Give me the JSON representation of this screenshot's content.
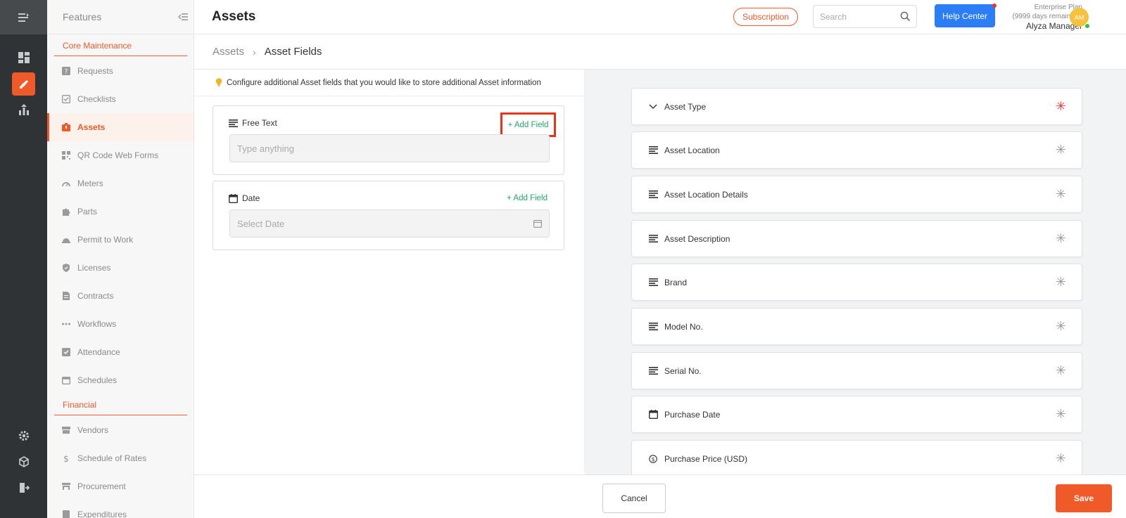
{
  "colors": {
    "accent": "#f05a28",
    "help": "#2c7ef8",
    "success": "#21a66a",
    "required": "#f03a2e"
  },
  "features": {
    "title": "Features",
    "sections": [
      {
        "title": "Core Maintenance",
        "items": [
          {
            "label": "Requests",
            "icon": "question-box-icon"
          },
          {
            "label": "Checklists",
            "icon": "checklist-icon"
          },
          {
            "label": "Assets",
            "icon": "asset-box-icon",
            "active": true
          },
          {
            "label": "QR Code Web Forms",
            "icon": "qr-code-icon"
          },
          {
            "label": "Meters",
            "icon": "gauge-icon"
          },
          {
            "label": "Parts",
            "icon": "puzzle-icon"
          },
          {
            "label": "Permit to Work",
            "icon": "helmet-icon"
          },
          {
            "label": "Licenses",
            "icon": "shield-icon"
          },
          {
            "label": "Contracts",
            "icon": "contract-icon"
          },
          {
            "label": "Workflows",
            "icon": "workflow-dots-icon"
          },
          {
            "label": "Attendance",
            "icon": "attendance-icon"
          },
          {
            "label": "Schedules",
            "icon": "calendar-icon"
          }
        ]
      },
      {
        "title": "Financial",
        "items": [
          {
            "label": "Vendors",
            "icon": "store-icon"
          },
          {
            "label": "Schedule of Rates",
            "icon": "dollar-icon"
          },
          {
            "label": "Procurement",
            "icon": "procurement-icon"
          },
          {
            "label": "Expenditures",
            "icon": "expenditure-icon"
          }
        ]
      }
    ]
  },
  "header": {
    "title": "Assets",
    "subscription_label": "Subscription",
    "search_placeholder": "Search",
    "help_label": "Help Center",
    "plan_name": "Enterprise Plan",
    "plan_remaining": "(9999 days remaining)",
    "user_name": "Alyza Manager",
    "avatar_initials": "AM"
  },
  "breadcrumb": {
    "root": "Assets",
    "current": "Asset Fields"
  },
  "left": {
    "hint": "Configure additional Asset fields that you would like to store additional Asset information",
    "fields": [
      {
        "label": "Free Text",
        "add_label": "+ Add Field",
        "placeholder": "Type anything",
        "icon": "text-lines-icon"
      },
      {
        "label": "Date",
        "add_label": "+ Add Field",
        "placeholder": "Select Date",
        "icon": "calendar-icon"
      }
    ]
  },
  "right": {
    "fields": [
      {
        "label": "Asset Type",
        "icon": "chevron-down-icon",
        "required": true
      },
      {
        "label": "Asset Location",
        "icon": "text-lines-icon",
        "required": false
      },
      {
        "label": "Asset Location Details",
        "icon": "text-lines-icon",
        "required": false
      },
      {
        "label": "Asset Description",
        "icon": "text-lines-icon",
        "required": false
      },
      {
        "label": "Brand",
        "icon": "text-lines-icon",
        "required": false
      },
      {
        "label": "Model No.",
        "icon": "text-lines-icon",
        "required": false
      },
      {
        "label": "Serial No.",
        "icon": "text-lines-icon",
        "required": false
      },
      {
        "label": "Purchase Date",
        "icon": "calendar-icon",
        "required": false
      },
      {
        "label": "Purchase Price (USD)",
        "icon": "dollar-circle-icon",
        "required": false
      }
    ],
    "required_marker": "✳"
  },
  "footer": {
    "cancel_label": "Cancel",
    "save_label": "Save"
  }
}
